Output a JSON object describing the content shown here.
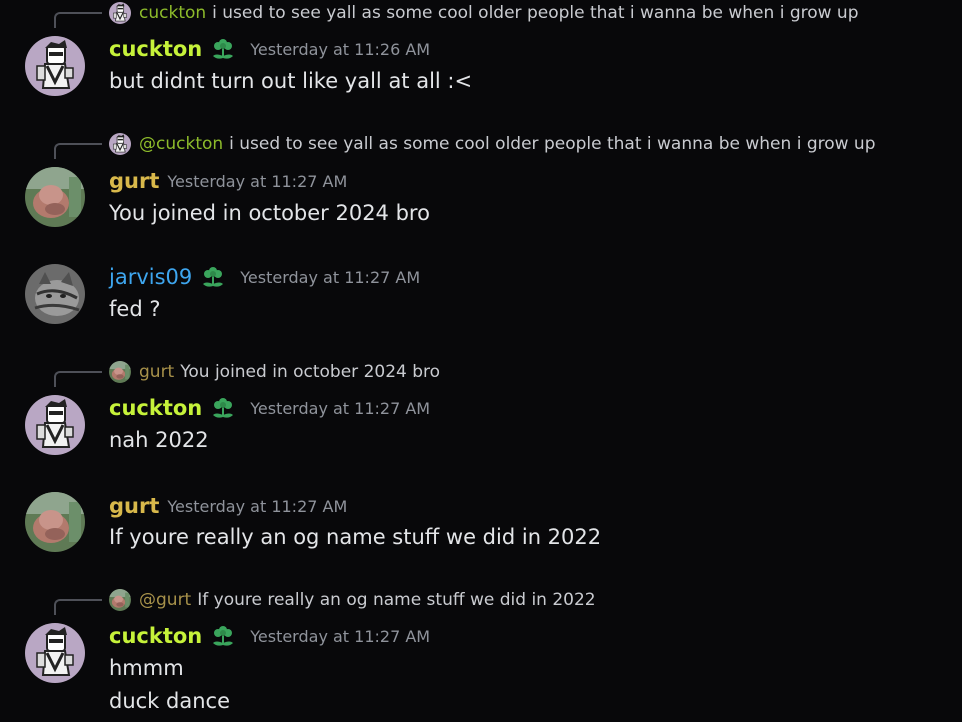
{
  "colors": {
    "cuckton": "#c6f23a",
    "gurt": "#d8b84b",
    "jarvis09": "#3ea6ef",
    "background": "#08080a",
    "badge": "#3aa55c"
  },
  "messages": [
    {
      "reply": {
        "name": "cuckton",
        "text": "i used to see yall as some cool older people that i wanna be when i grow up"
      },
      "author": "cuckton",
      "badge": "flower-badge-icon",
      "timestamp": "Yesterday at 11:26 AM",
      "lines": [
        "but didnt turn out like yall at all :<"
      ]
    },
    {
      "reply": {
        "name": "@cuckton",
        "text": "i used to see yall as some cool older people that i wanna be when i grow up"
      },
      "author": "gurt",
      "timestamp": "Yesterday at 11:27 AM",
      "lines": [
        "You joined in october 2024 bro"
      ]
    },
    {
      "author": "jarvis09",
      "badge": "flower-badge-icon",
      "timestamp": "Yesterday at 11:27 AM",
      "lines": [
        "fed ?"
      ]
    },
    {
      "reply": {
        "name": "gurt",
        "text": "You joined in october 2024 bro"
      },
      "author": "cuckton",
      "badge": "flower-badge-icon",
      "timestamp": "Yesterday at 11:27 AM",
      "lines": [
        "nah 2022"
      ]
    },
    {
      "author": "gurt",
      "timestamp": "Yesterday at 11:27 AM",
      "lines": [
        "If youre really an og name stuff we did in 2022"
      ]
    },
    {
      "reply": {
        "name": "@gurt",
        "text": "If youre really an og name stuff we did in 2022"
      },
      "author": "cuckton",
      "badge": "flower-badge-icon",
      "timestamp": "Yesterday at 11:27 AM",
      "lines": [
        "hmmm",
        "duck dance"
      ]
    }
  ]
}
